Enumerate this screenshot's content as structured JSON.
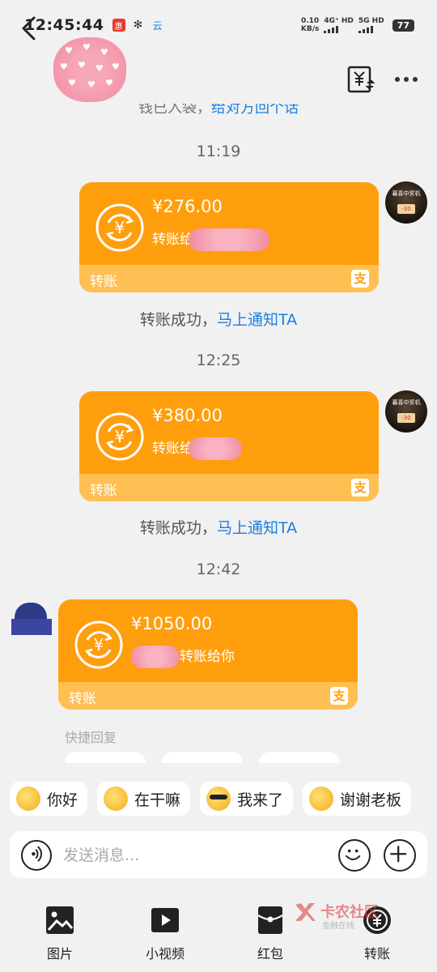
{
  "status_bar": {
    "time": "12:45:44",
    "net_speed_value": "0.10",
    "net_speed_unit": "KB/s",
    "sig1": "4G⁺ HD",
    "sig2": "5G HD",
    "battery": "77"
  },
  "header": {
    "cut_text_prefix": "钱已入袋，",
    "cut_text_link": "给对方回个话"
  },
  "messages": [
    {
      "time": "11:19",
      "amount": "¥276.00",
      "desc": "转账给",
      "bottom_label": "转账",
      "notice_text": "转账成功，",
      "notice_link": "马上通知TA"
    },
    {
      "time": "12:25",
      "amount": "¥380.00",
      "desc": "转账给",
      "bottom_label": "转账",
      "notice_text": "转账成功，",
      "notice_link": "马上通知TA"
    },
    {
      "time": "12:42",
      "amount": "¥1050.00",
      "desc": "转账给你",
      "bottom_label": "转账"
    }
  ],
  "my_avatar": {
    "line1": "暮喜中奖机",
    "badge": "-30"
  },
  "quick_reply": {
    "title": "快捷回复"
  },
  "chips": [
    {
      "label": "你好"
    },
    {
      "label": "在干嘛"
    },
    {
      "label": "我来了"
    },
    {
      "label": "谢谢老板"
    }
  ],
  "input": {
    "placeholder": "发送消息..."
  },
  "toolbar": [
    {
      "label": "图片",
      "icon": "image-icon"
    },
    {
      "label": "小视频",
      "icon": "video-icon"
    },
    {
      "label": "红包",
      "icon": "red-packet-icon"
    },
    {
      "label": "转账",
      "icon": "transfer-icon"
    }
  ],
  "watermark": {
    "line1": "卡农社区",
    "line2": "金融在线"
  },
  "colors": {
    "card_orange": "#ff9e0d",
    "card_bottom": "#ffbf52",
    "link_blue": "#1a7fe0",
    "background": "#f1f1f1"
  }
}
